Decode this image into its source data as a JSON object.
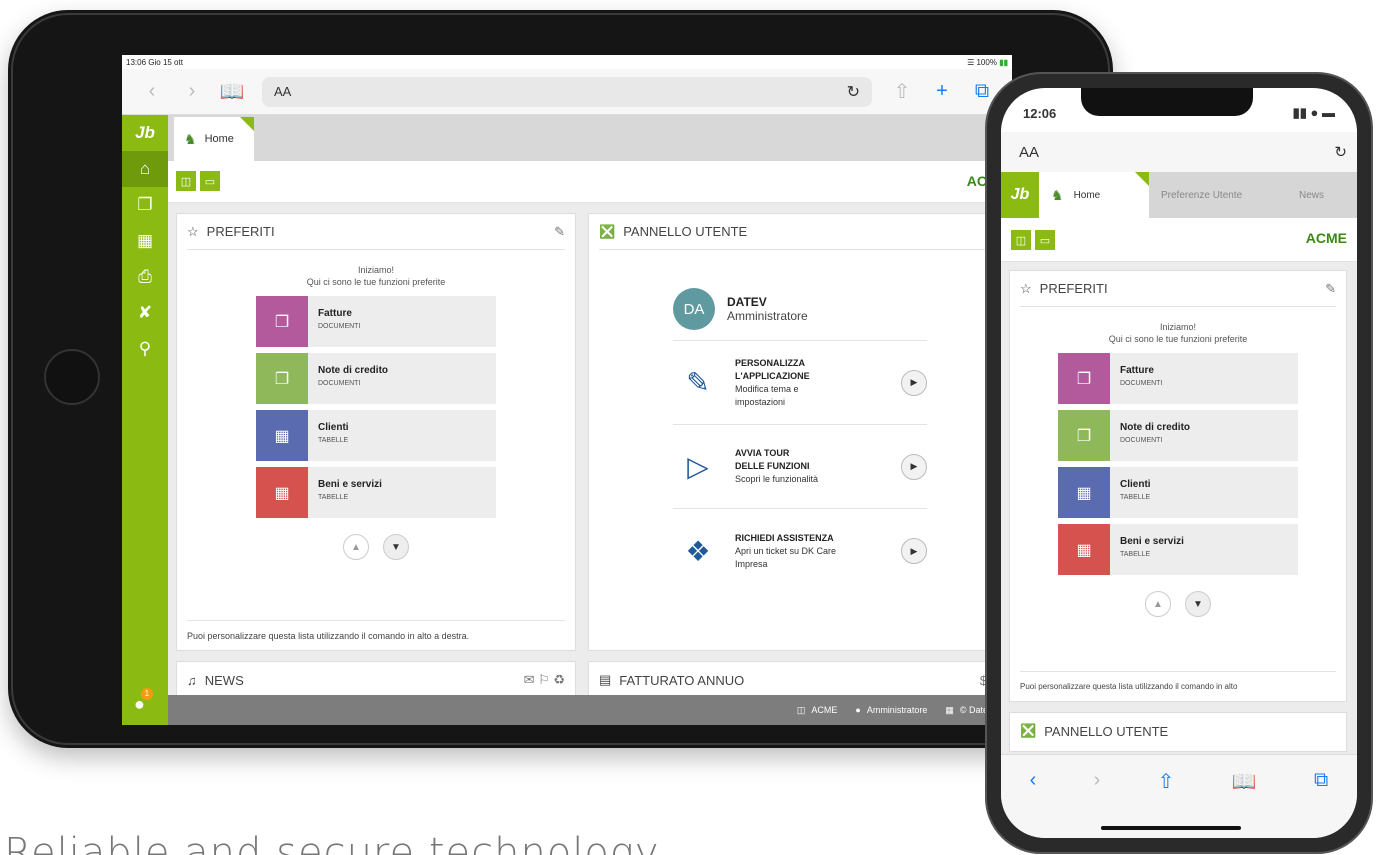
{
  "tablet": {
    "status_time": "13:06",
    "status_date": "Gio 15 ott",
    "battery": "100%",
    "url_text": "AA",
    "tab_home": "Home",
    "acme": "ACME",
    "preferiti": {
      "title": "PREFERITI",
      "intro1": "Iniziamo!",
      "intro2": "Qui ci sono le tue funzioni preferite",
      "items": [
        {
          "title": "Fatture",
          "sub": "DOCUMENTI",
          "color": "#b35a9c"
        },
        {
          "title": "Note di credito",
          "sub": "DOCUMENTI",
          "color": "#8fb85a"
        },
        {
          "title": "Clienti",
          "sub": "TABELLE",
          "color": "#5b6bb0"
        },
        {
          "title": "Beni e servizi",
          "sub": "TABELLE",
          "color": "#d5524f"
        }
      ],
      "footer": "Puoi personalizzare questa lista utilizzando il comando in alto a destra."
    },
    "pannello": {
      "title": "PANNELLO UTENTE",
      "avatar": "DA",
      "user_name": "DATEV",
      "user_role": "Amministratore",
      "actions": [
        {
          "l1": "PERSONALIZZA",
          "l2": "L'APPLICAZIONE",
          "d1": "Modifica tema e",
          "d2": "impostazioni",
          "icon": "brush-icon"
        },
        {
          "l1": "AVVIA TOUR",
          "l2": "DELLE FUNZIONI",
          "d1": "Scopri le funzionalità",
          "d2": "",
          "icon": "laptop-play-icon"
        },
        {
          "l1": "RICHIEDI ASSISTENZA",
          "l2": "",
          "d1": "Apri un ticket su DK Care",
          "d2": "Impresa",
          "icon": "puzzle-icon"
        }
      ]
    },
    "news_title": "NEWS",
    "fatturato_title": "FATTURATO ANNUO",
    "footer": {
      "company": "ACME",
      "user": "Amministratore",
      "copyright": "© Datev Koi"
    },
    "badge_count": "1"
  },
  "phone": {
    "status_time": "12:06",
    "url_text": "AA",
    "tabs": [
      "Home",
      "Preferenze Utente",
      "News"
    ],
    "acme": "ACME",
    "preferiti": {
      "title": "PREFERITI",
      "intro1": "Iniziamo!",
      "intro2": "Qui ci sono le tue funzioni preferite",
      "items": [
        {
          "title": "Fatture",
          "sub": "DOCUMENTI"
        },
        {
          "title": "Note di credito",
          "sub": "DOCUMENTI"
        },
        {
          "title": "Clienti",
          "sub": "TABELLE"
        },
        {
          "title": "Beni e servizi",
          "sub": "TABELLE"
        }
      ],
      "footer": "Puoi personalizzare questa lista utilizzando il comando in alto"
    },
    "pannello_title": "PANNELLO UTENTE"
  },
  "tagline": "Reliable and secure technology"
}
